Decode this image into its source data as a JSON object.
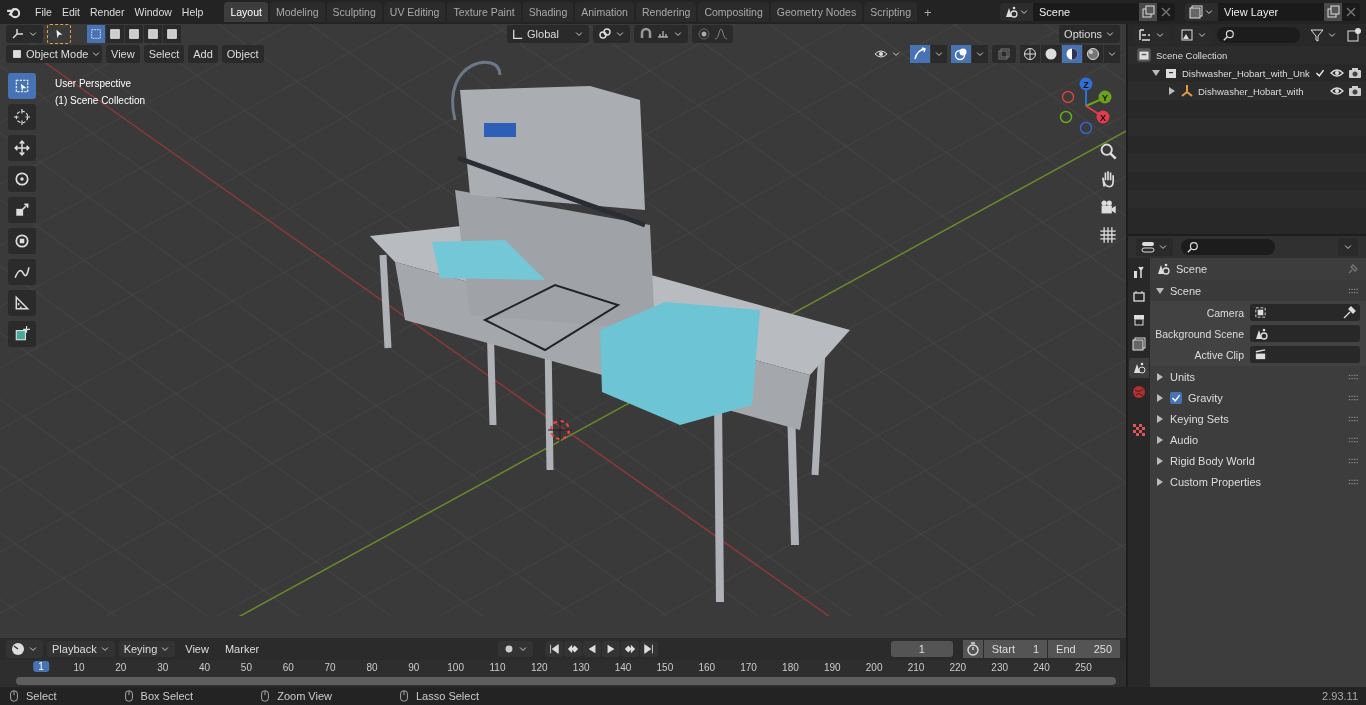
{
  "top_bar": {
    "menus": [
      "File",
      "Edit",
      "Render",
      "Window",
      "Help"
    ],
    "workspace_tabs": [
      {
        "label": "Layout",
        "selected": true
      },
      {
        "label": "Modeling",
        "selected": false
      },
      {
        "label": "Sculpting",
        "selected": false
      },
      {
        "label": "UV Editing",
        "selected": false
      },
      {
        "label": "Texture Paint",
        "selected": false
      },
      {
        "label": "Shading",
        "selected": false
      },
      {
        "label": "Animation",
        "selected": false
      },
      {
        "label": "Rendering",
        "selected": false
      },
      {
        "label": "Compositing",
        "selected": false
      },
      {
        "label": "Geometry Nodes",
        "selected": false
      },
      {
        "label": "Scripting",
        "selected": false
      }
    ],
    "add_tab": "+",
    "scene": "Scene",
    "view_layer": "View Layer"
  },
  "viewport": {
    "select_modes": [
      {
        "selected": true
      },
      {
        "selected": false
      },
      {
        "selected": false
      },
      {
        "selected": false
      },
      {
        "selected": false
      }
    ],
    "transform_orientation": "Global",
    "options": "Options",
    "mode": "Object Mode",
    "menus": [
      "View",
      "Select",
      "Add",
      "Object"
    ],
    "shading_modes": [
      {
        "selected": false
      },
      {
        "selected": false
      },
      {
        "selected": true
      },
      {
        "selected": false
      }
    ],
    "overlay_text": [
      "User Perspective",
      "(1) Scene Collection"
    ],
    "tools": [
      {
        "selected": true
      },
      {
        "selected": false
      },
      {
        "selected": false
      },
      {
        "selected": false
      },
      {
        "selected": false
      },
      {
        "selected": false
      },
      {
        "selected": false
      },
      {
        "selected": false
      },
      {
        "selected": false
      }
    ],
    "gizmo_axes": [
      {
        "label": "Z",
        "color": "#2f6fd6"
      },
      {
        "label": "Y",
        "color": "#6ba21a"
      },
      {
        "label": "X",
        "color": "#e33a50"
      }
    ]
  },
  "outliner": {
    "items": [
      {
        "label": "Scene Collection",
        "kind": "scene",
        "children": [
          {
            "label": "Dishwasher_Hobart_with_Unk",
            "kind": "collection",
            "expanded": true,
            "checked": true,
            "children": [
              {
                "label": "Dishwasher_Hobart_with",
                "kind": "object",
                "expanded": false
              }
            ]
          }
        ]
      }
    ]
  },
  "properties": {
    "tabs": [
      {
        "selected": false
      },
      {
        "selected": false
      },
      {
        "selected": false
      },
      {
        "selected": false
      },
      {
        "selected": true
      },
      {
        "selected": false
      },
      {
        "selected": false
      }
    ],
    "context": "Scene",
    "panel": {
      "title": "Scene",
      "expanded": true,
      "fields": [
        {
          "label": "Camera"
        },
        {
          "label": "Background Scene"
        },
        {
          "label": "Active Clip"
        }
      ]
    },
    "subpanels": [
      {
        "label": "Units",
        "kind": "plain",
        "expanded": false
      },
      {
        "label": "Gravity",
        "kind": "checkbox",
        "checked": true,
        "expanded": false
      },
      {
        "label": "Keying Sets",
        "kind": "plain",
        "expanded": false
      },
      {
        "label": "Audio",
        "kind": "plain",
        "expanded": false
      },
      {
        "label": "Rigid Body World",
        "kind": "plain",
        "expanded": false
      },
      {
        "label": "Custom Properties",
        "kind": "plain",
        "expanded": false
      }
    ]
  },
  "timeline": {
    "menus": [
      {
        "label": "Playback",
        "kind": "dropdown"
      },
      {
        "label": "Keying",
        "kind": "dropdown"
      },
      {
        "label": "View",
        "kind": "menu"
      },
      {
        "label": "Marker",
        "kind": "menu"
      }
    ],
    "current_frame": "1",
    "start_label": "Start",
    "start": "1",
    "end_label": "End",
    "end": "250",
    "ruler": [
      {
        "label": "1",
        "selected": true
      },
      {
        "label": "10",
        "selected": false
      },
      {
        "label": "20",
        "selected": false
      },
      {
        "label": "30",
        "selected": false
      },
      {
        "label": "40",
        "selected": false
      },
      {
        "label": "50",
        "selected": false
      },
      {
        "label": "60",
        "selected": false
      },
      {
        "label": "70",
        "selected": false
      },
      {
        "label": "80",
        "selected": false
      },
      {
        "label": "90",
        "selected": false
      },
      {
        "label": "100",
        "selected": false
      },
      {
        "label": "110",
        "selected": false
      },
      {
        "label": "120",
        "selected": false
      },
      {
        "label": "130",
        "selected": false
      },
      {
        "label": "140",
        "selected": false
      },
      {
        "label": "150",
        "selected": false
      },
      {
        "label": "160",
        "selected": false
      },
      {
        "label": "170",
        "selected": false
      },
      {
        "label": "180",
        "selected": false
      },
      {
        "label": "190",
        "selected": false
      },
      {
        "label": "200",
        "selected": false
      },
      {
        "label": "210",
        "selected": false
      },
      {
        "label": "220",
        "selected": false
      },
      {
        "label": "230",
        "selected": false
      },
      {
        "label": "240",
        "selected": false
      },
      {
        "label": "250",
        "selected": false
      }
    ]
  },
  "status_bar": {
    "hints": [
      "Select",
      "Box Select",
      "Zoom View",
      "Lasso Select"
    ],
    "version": "2.93.11"
  }
}
